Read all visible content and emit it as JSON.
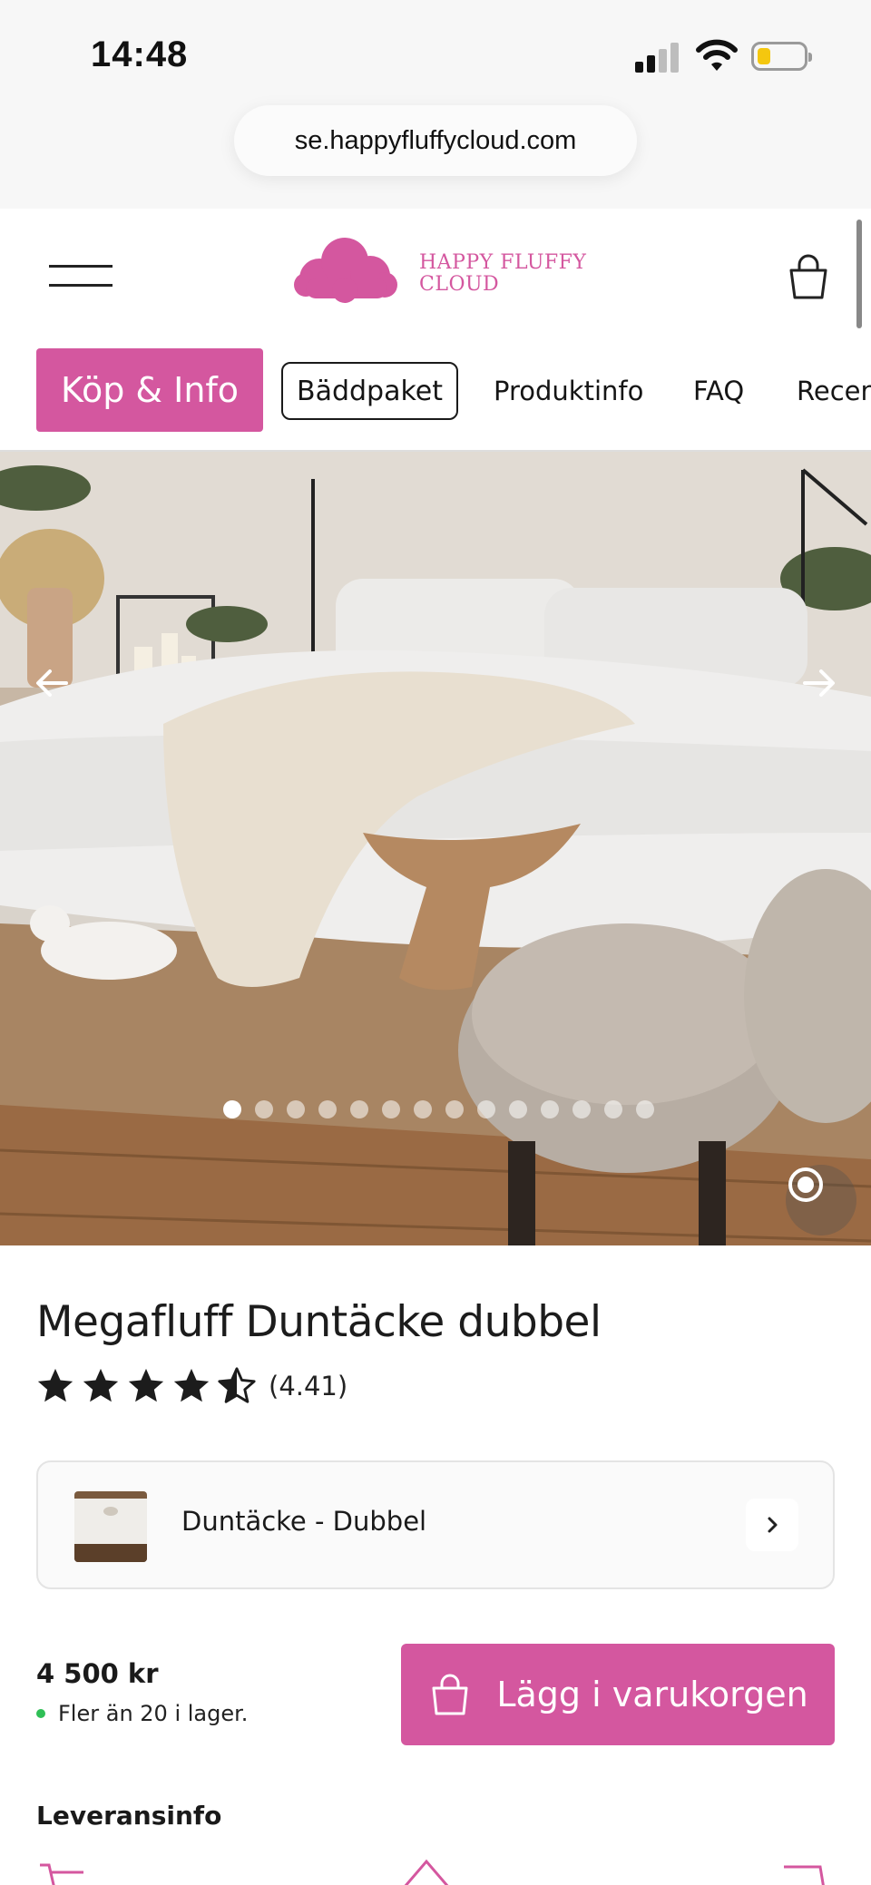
{
  "status_bar": {
    "time": "14:48"
  },
  "browser": {
    "url": "se.happyfluffycloud.com"
  },
  "header": {
    "brand_line1": "HAPPY FLUFFY",
    "brand_line2": "CLOUD",
    "brand_color": "#d4579f"
  },
  "tabs": [
    {
      "label": "Köp & Info",
      "state": "active"
    },
    {
      "label": "Bäddpaket",
      "state": "outlined"
    },
    {
      "label": "Produktinfo",
      "state": "normal"
    },
    {
      "label": "FAQ",
      "state": "normal"
    },
    {
      "label": "Recen",
      "state": "normal"
    }
  ],
  "gallery": {
    "image_count": 14,
    "current_index": 1
  },
  "product": {
    "title": "Megafluff Duntäcke dubbel",
    "rating_value": 4.41,
    "rating_text": "(4.41)",
    "variant_label": "Duntäcke - Dubbel",
    "price": "4 500 kr",
    "stock": "Fler än 20 i lager.",
    "stock_color": "#2fbf56",
    "add_to_cart": "Lägg i varukorgen"
  },
  "delivery": {
    "heading": "Leveransinfo"
  },
  "icons": [
    "menu-icon",
    "cloud-logo-icon",
    "bag-icon",
    "arrow-left-icon",
    "arrow-right-icon",
    "record-icon",
    "star-icon",
    "chevron-right-icon",
    "shopping-bag-icon",
    "cart-icon",
    "home-icon"
  ]
}
